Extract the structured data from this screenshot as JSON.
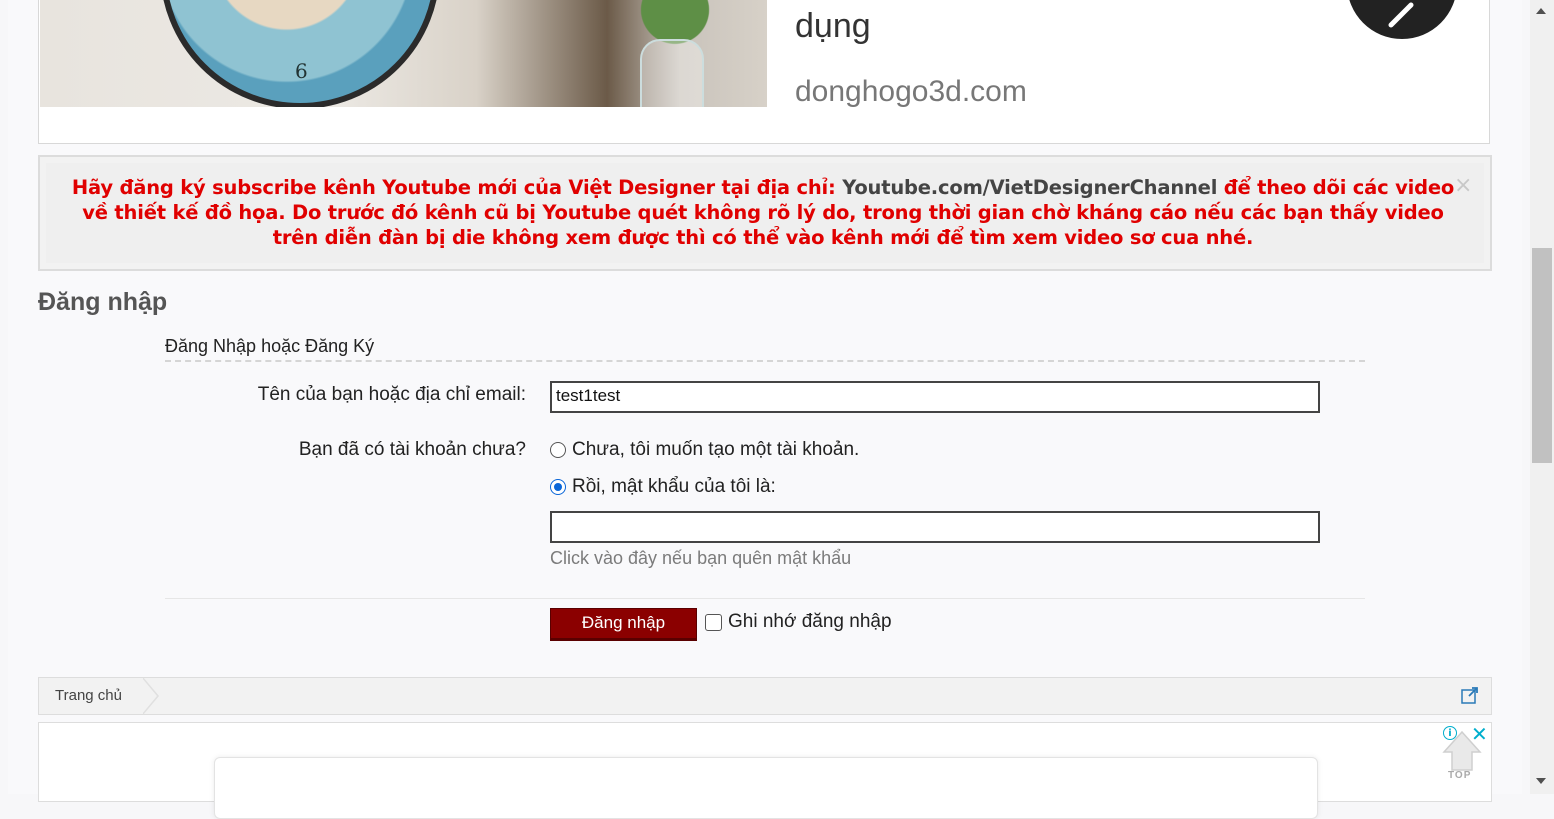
{
  "ad_top": {
    "headline": "dụng",
    "domain": "donghogo3d.com",
    "clock_number": "6"
  },
  "notice": {
    "text_part1": "Hãy đăng ký subscribe kênh Youtube mới của Việt Designer tại địa chỉ: ",
    "link_text": "Youtube.com/VietDesignerChannel",
    "text_part2": " để theo dõi các video về thiết kế đồ họa. Do trước đó kênh cũ bị Youtube quét không rõ lý do, trong thời gian chờ kháng cáo nếu các bạn thấy video trên diễn đàn bị die không xem được thì có thể vào kênh mới để tìm xem video sơ cua nhé.",
    "close_glyph": "×"
  },
  "login": {
    "title": "Đăng nhập",
    "section_heading": "Đăng Nhập hoặc Đăng Ký",
    "username_label": "Tên của bạn hoặc địa chỉ email:",
    "username_value": "test1test",
    "account_question": "Bạn đã có tài khoản chưa?",
    "option_no": "Chưa, tôi muốn tạo một tài khoản.",
    "option_yes": "Rồi, mật khẩu của tôi là:",
    "selected_option": "yes",
    "password_value": "",
    "forgot_link": "Click vào đây nếu bạn quên mật khẩu",
    "submit_label": "Đăng nhập",
    "remember_label": "Ghi nhớ đăng nhập",
    "remember_checked": false
  },
  "breadcrumb": {
    "home": "Trang chủ"
  },
  "ad_bottom": {
    "info_glyph": "i",
    "close_glyph": "✕"
  },
  "back_to_top": {
    "label": "TOP"
  },
  "colors": {
    "notice_red": "#e00000",
    "button_dark_red": "#8b0000",
    "radio_blue": "#0a66d8",
    "adchoice_teal": "#00aecd"
  }
}
